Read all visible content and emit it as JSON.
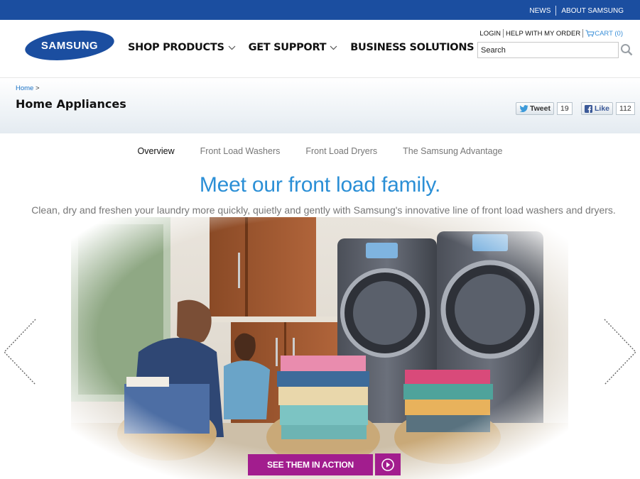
{
  "topbar": {
    "news": "NEWS",
    "about": "ABOUT SAMSUNG"
  },
  "header": {
    "logo_text": "SAMSUNG",
    "nav": [
      {
        "label": "SHOP PRODUCTS",
        "has_dropdown": true
      },
      {
        "label": "GET SUPPORT",
        "has_dropdown": true
      },
      {
        "label": "BUSINESS SOLUTIONS",
        "has_dropdown": false
      }
    ],
    "login": "LOGIN",
    "help": "HELP WITH MY ORDER",
    "cart": "CART (0)",
    "search_value": "Search"
  },
  "breadcrumb": {
    "home": "Home",
    "separator": ">"
  },
  "page_title": "Home Appliances",
  "social": {
    "tweet_label": "Tweet",
    "tweet_count": "19",
    "like_label": "Like",
    "like_count": "112"
  },
  "subnav": [
    "Overview",
    "Front Load Washers",
    "Front Load Dryers",
    "The Samsung Advantage"
  ],
  "hero": {
    "headline": "Meet our front load family.",
    "subline": "Clean, dry and freshen your laundry more quickly, quietly and gently with Samsung's innovative line of front load washers and dryers.",
    "cta_label": "SEE THEM IN ACTION"
  },
  "colors": {
    "brand_blue": "#1b4ea0",
    "accent_blue": "#2b8fd6",
    "cta_magenta": "#a21d8e"
  }
}
